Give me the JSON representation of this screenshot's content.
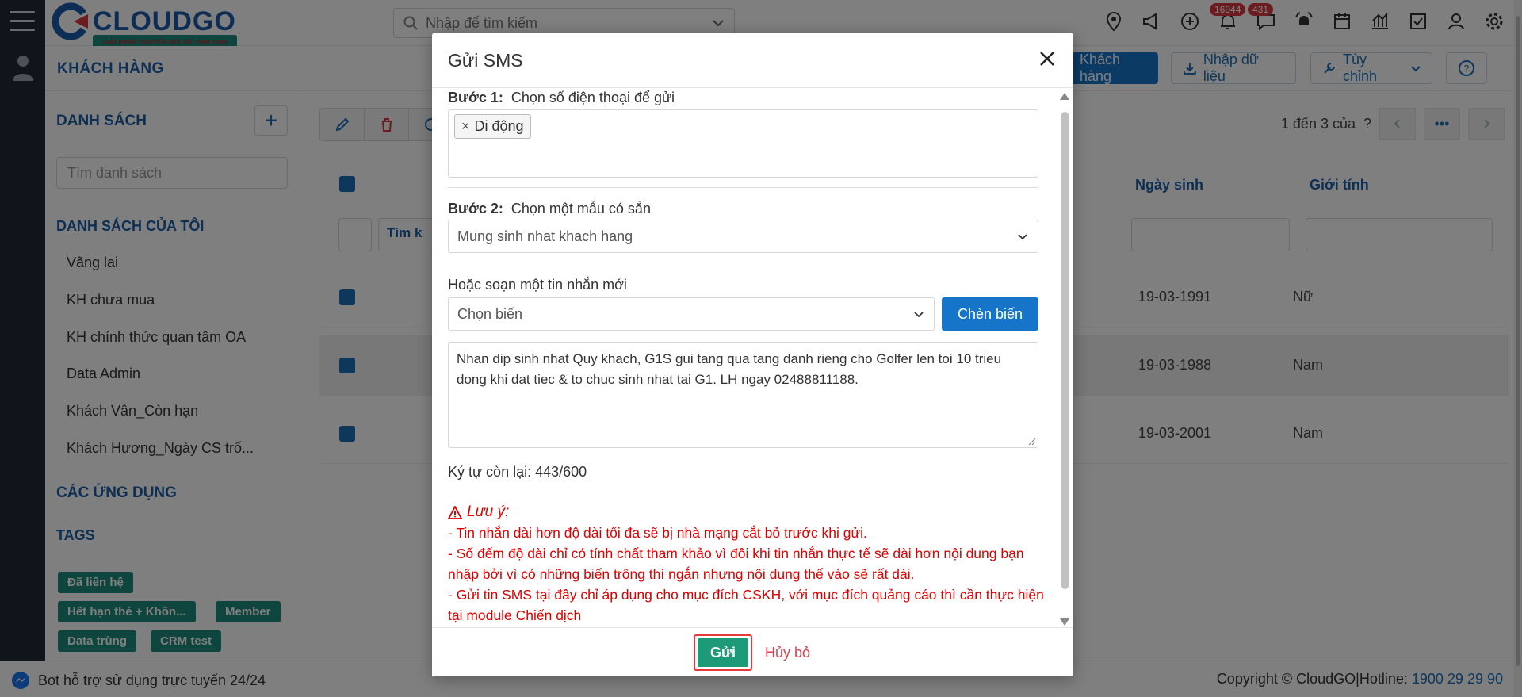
{
  "topbar": {
    "logo_name": "CLOUDGO",
    "logo_tagline": "GIẢI PHÁP CHUYỂN ĐỔI SỐ TINH GỌN",
    "search_placeholder": "Nhập để tìm kiếm",
    "notif_badge": "16944",
    "chat_badge": "431"
  },
  "subheader": {
    "title": "KHÁCH HÀNG",
    "btn_add": "Khách hàng",
    "btn_import": "Nhập dữ liệu",
    "btn_custom": "Tùy chỉnh"
  },
  "sidebar": {
    "list_title": "DANH SÁCH",
    "search_placeholder": "Tìm danh sách",
    "my_lists_title": "DANH SÁCH CỦA TÔI",
    "items": [
      "Vãng lai",
      "KH chưa mua",
      "KH chính thức quan tâm OA",
      "Data Admin",
      "Khách Vân_Còn hạn",
      "Khách Hương_Ngày CS trố..."
    ],
    "apps_title": "CÁC ỨNG DỤNG",
    "tags_title": "TAGS",
    "tags": [
      "Đã liên hệ",
      "Hết hạn thẻ + Khôn...",
      "Member",
      "Data trùng",
      "CRM test"
    ]
  },
  "main": {
    "pager_text": "1 đến 3 của",
    "pager_q": "?",
    "search_hint": "Tìm k",
    "col_birthday": "Ngày sinh",
    "col_gender": "Giới tính",
    "rows": [
      {
        "birthday": "19-03-1991",
        "gender": "Nữ"
      },
      {
        "birthday": "19-03-1988",
        "gender": "Nam"
      },
      {
        "birthday": "19-03-2001",
        "gender": "Nam"
      }
    ]
  },
  "footer": {
    "bot_text": "Bot hỗ trợ sử dụng trực tuyến 24/24",
    "copyright": "Copyright © CloudGO|Hotline:",
    "hotline": "1900 29 29 90"
  },
  "modal": {
    "title": "Gửi SMS",
    "step1_label": "Bước 1:",
    "step1_text": "Chọn số điện thoại để gửi",
    "chip": "Di động",
    "step2_label": "Bước 2:",
    "step2_text": "Chọn một mẫu có sẵn",
    "template_value": "Mung sinh nhat khach hang",
    "compose_label": "Hoặc soạn một tin nhắn mới",
    "var_placeholder": "Chọn biến",
    "insert_btn": "Chèn biến",
    "message": "Nhan dip sinh nhat Quy khach, G1S gui tang qua tang danh rieng cho Golfer len toi 10 trieu dong khi dat tiec & to chuc sinh nhat tai G1. LH ngay 02488811188.",
    "counter": "Ký tự còn lại: 443/600",
    "warning_title": "Lưu ý:",
    "warning_lines": [
      "- Tin nhắn dài hơn độ dài tối đa sẽ bị nhà mạng cắt bỏ trước khi gửi.",
      "- Số đếm độ dài chỉ có tính chất tham khảo vì đôi khi tin nhắn thực tế sẽ dài hơn nội dung bạn nhập bởi vì có những biến trông thì ngắn nhưng nội dung thế vào sẽ rất dài.",
      "- Gửi tin SMS tại đây chỉ áp dụng cho mục đích CSKH, với mục đích quảng cáo thì cần thực hiện tại module Chiến dịch"
    ],
    "send_btn": "Gửi",
    "cancel_btn": "Hủy bỏ"
  },
  "colors": {
    "primary": "#1675c8",
    "send": "#1d9a78",
    "warning": "#e00000",
    "tag": "#1d8a7c"
  }
}
